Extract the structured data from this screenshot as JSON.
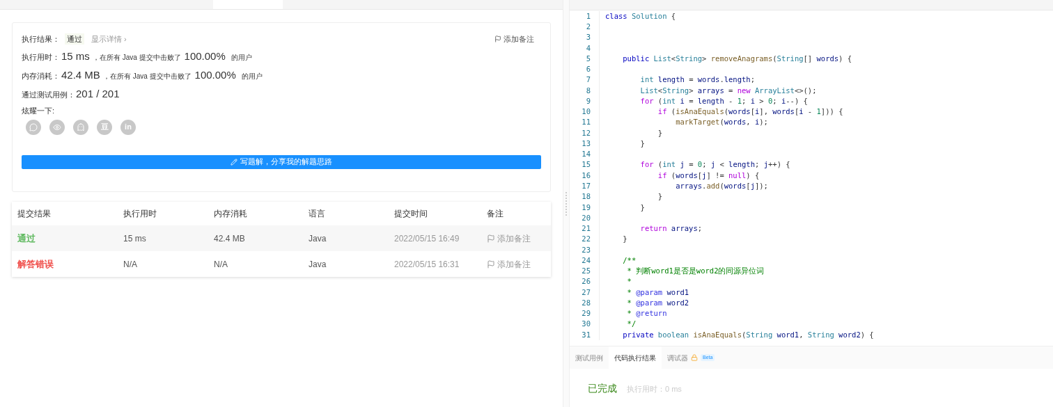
{
  "summary": {
    "result_label": "执行结果：",
    "result_badge": "通过",
    "details_link": "显示详情 ›",
    "add_note": "添加备注",
    "stats": [
      {
        "label": "执行用时：",
        "value": "15 ms",
        "text": "，在所有 Java 提交中击败了",
        "percent": "100.00%",
        "suffix": "的用户"
      },
      {
        "label": "内存消耗：",
        "value": "42.4 MB",
        "text": "，在所有 Java 提交中击败了",
        "percent": "100.00%",
        "suffix": "的用户"
      }
    ],
    "tests_label": "通过测试用例：",
    "tests_value": "201 / 201",
    "share_label": "炫耀一下:",
    "share_icons": [
      {
        "kind": "chat"
      },
      {
        "kind": "eye"
      },
      {
        "kind": "penguin"
      },
      {
        "kind": "glyph",
        "text": "豆"
      },
      {
        "kind": "glyph",
        "text": "in"
      }
    ],
    "write_button": "写题解，分享我的解题思路"
  },
  "table": {
    "columns": [
      "提交结果",
      "执行用时",
      "内存消耗",
      "语言",
      "提交时间",
      "备注"
    ],
    "rows": [
      {
        "status": "通过",
        "color": "#5cb85c",
        "runtime": "15 ms",
        "memory": "42.4 MB",
        "language": "Java",
        "time": "2022/05/15 16:49",
        "note": "添加备注"
      },
      {
        "status": "解答错误",
        "color": "#f0504c",
        "runtime": "N/A",
        "memory": "N/A",
        "language": "Java",
        "time": "2022/05/15 16:31",
        "note": "添加备注"
      }
    ]
  },
  "editor": {
    "lines": [
      {
        "number": "1",
        "tokens": [
          {
            "text": "class",
            "kind": "kw"
          },
          {
            "text": " Solution",
            "kind": "type"
          },
          {
            "text": " {",
            "kind": "p"
          }
        ]
      },
      {
        "number": "2"
      },
      {
        "number": "3"
      },
      {
        "number": "4"
      },
      {
        "number": "5",
        "tokens": [
          {
            "text": "    public",
            "kind": "kw"
          },
          {
            "text": " List",
            "kind": "type"
          },
          {
            "text": "<",
            "kind": "p"
          },
          {
            "text": "String",
            "kind": "type"
          },
          {
            "text": "> ",
            "kind": "p"
          },
          {
            "text": "removeAnagrams",
            "kind": "fn"
          },
          {
            "text": "(",
            "kind": "p"
          },
          {
            "text": "String",
            "kind": "type"
          },
          {
            "text": "[] ",
            "kind": "p"
          },
          {
            "text": "words",
            "kind": "var"
          },
          {
            "text": ") {",
            "kind": "p"
          }
        ]
      },
      {
        "number": "6"
      },
      {
        "number": "7",
        "tokens": [
          {
            "text": "        int",
            "kind": "type"
          },
          {
            "text": " length",
            "kind": "var"
          },
          {
            "text": " = ",
            "kind": "p"
          },
          {
            "text": "words",
            "kind": "var"
          },
          {
            "text": ".",
            "kind": "p"
          },
          {
            "text": "length",
            "kind": "var"
          },
          {
            "text": ";",
            "kind": "p"
          }
        ]
      },
      {
        "number": "8",
        "tokens": [
          {
            "text": "        List",
            "kind": "type"
          },
          {
            "text": "<",
            "kind": "p"
          },
          {
            "text": "String",
            "kind": "type"
          },
          {
            "text": "> ",
            "kind": "p"
          },
          {
            "text": "arrays",
            "kind": "var"
          },
          {
            "text": " = ",
            "kind": "p"
          },
          {
            "text": "new",
            "kind": "ctrl"
          },
          {
            "text": " ArrayList",
            "kind": "type"
          },
          {
            "text": "<>();",
            "kind": "p"
          }
        ]
      },
      {
        "number": "9",
        "tokens": [
          {
            "text": "        for",
            "kind": "ctrl"
          },
          {
            "text": " (",
            "kind": "p"
          },
          {
            "text": "int",
            "kind": "type"
          },
          {
            "text": " i",
            "kind": "var"
          },
          {
            "text": " = ",
            "kind": "p"
          },
          {
            "text": "length",
            "kind": "var"
          },
          {
            "text": " - ",
            "kind": "p"
          },
          {
            "text": "1",
            "kind": "num"
          },
          {
            "text": "; ",
            "kind": "p"
          },
          {
            "text": "i",
            "kind": "var"
          },
          {
            "text": " > ",
            "kind": "p"
          },
          {
            "text": "0",
            "kind": "num"
          },
          {
            "text": "; ",
            "kind": "p"
          },
          {
            "text": "i",
            "kind": "var"
          },
          {
            "text": "--) {",
            "kind": "p"
          }
        ]
      },
      {
        "number": "10",
        "tokens": [
          {
            "text": "            if",
            "kind": "ctrl"
          },
          {
            "text": " (",
            "kind": "p"
          },
          {
            "text": "isAnaEquals",
            "kind": "fn"
          },
          {
            "text": "(",
            "kind": "p"
          },
          {
            "text": "words",
            "kind": "var"
          },
          {
            "text": "[",
            "kind": "p"
          },
          {
            "text": "i",
            "kind": "var"
          },
          {
            "text": "], ",
            "kind": "p"
          },
          {
            "text": "words",
            "kind": "var"
          },
          {
            "text": "[",
            "kind": "p"
          },
          {
            "text": "i",
            "kind": "var"
          },
          {
            "text": " - ",
            "kind": "p"
          },
          {
            "text": "1",
            "kind": "num"
          },
          {
            "text": "])) {",
            "kind": "p"
          }
        ]
      },
      {
        "number": "11",
        "tokens": [
          {
            "text": "                markTarget",
            "kind": "fn"
          },
          {
            "text": "(",
            "kind": "p"
          },
          {
            "text": "words",
            "kind": "var"
          },
          {
            "text": ", ",
            "kind": "p"
          },
          {
            "text": "i",
            "kind": "var"
          },
          {
            "text": ");",
            "kind": "p"
          }
        ]
      },
      {
        "number": "12",
        "tokens": [
          {
            "text": "            }",
            "kind": "p"
          }
        ]
      },
      {
        "number": "13",
        "tokens": [
          {
            "text": "        }",
            "kind": "p"
          }
        ]
      },
      {
        "number": "14"
      },
      {
        "number": "15",
        "tokens": [
          {
            "text": "        for",
            "kind": "ctrl"
          },
          {
            "text": " (",
            "kind": "p"
          },
          {
            "text": "int",
            "kind": "type"
          },
          {
            "text": " j",
            "kind": "var"
          },
          {
            "text": " = ",
            "kind": "p"
          },
          {
            "text": "0",
            "kind": "num"
          },
          {
            "text": "; ",
            "kind": "p"
          },
          {
            "text": "j",
            "kind": "var"
          },
          {
            "text": " < ",
            "kind": "p"
          },
          {
            "text": "length",
            "kind": "var"
          },
          {
            "text": "; ",
            "kind": "p"
          },
          {
            "text": "j",
            "kind": "var"
          },
          {
            "text": "++) {",
            "kind": "p"
          }
        ]
      },
      {
        "number": "16",
        "tokens": [
          {
            "text": "            if",
            "kind": "ctrl"
          },
          {
            "text": " (",
            "kind": "p"
          },
          {
            "text": "words",
            "kind": "var"
          },
          {
            "text": "[",
            "kind": "p"
          },
          {
            "text": "j",
            "kind": "var"
          },
          {
            "text": "] != ",
            "kind": "p"
          },
          {
            "text": "null",
            "kind": "ctrl"
          },
          {
            "text": ") {",
            "kind": "p"
          }
        ]
      },
      {
        "number": "17",
        "tokens": [
          {
            "text": "                arrays",
            "kind": "var"
          },
          {
            "text": ".",
            "kind": "p"
          },
          {
            "text": "add",
            "kind": "fn"
          },
          {
            "text": "(",
            "kind": "p"
          },
          {
            "text": "words",
            "kind": "var"
          },
          {
            "text": "[",
            "kind": "p"
          },
          {
            "text": "j",
            "kind": "var"
          },
          {
            "text": "]);",
            "kind": "p"
          }
        ]
      },
      {
        "number": "18",
        "tokens": [
          {
            "text": "            }",
            "kind": "p"
          }
        ]
      },
      {
        "number": "19",
        "tokens": [
          {
            "text": "        }",
            "kind": "p"
          }
        ]
      },
      {
        "number": "20"
      },
      {
        "number": "21",
        "tokens": [
          {
            "text": "        return",
            "kind": "ctrl"
          },
          {
            "text": " arrays",
            "kind": "var"
          },
          {
            "text": ";",
            "kind": "p"
          }
        ]
      },
      {
        "number": "22",
        "tokens": [
          {
            "text": "    }",
            "kind": "p"
          }
        ]
      },
      {
        "number": "23"
      },
      {
        "number": "24",
        "tokens": [
          {
            "text": "    /**",
            "kind": "comment"
          }
        ]
      },
      {
        "number": "25",
        "tokens": [
          {
            "text": "     * 判断word1是否是word2的同源异位词",
            "kind": "comment"
          }
        ]
      },
      {
        "number": "26",
        "tokens": [
          {
            "text": "     *",
            "kind": "comment"
          }
        ]
      },
      {
        "number": "27",
        "tokens": [
          {
            "text": "     *",
            "kind": "comment"
          },
          {
            "text": " @param",
            "kind": "tag"
          },
          {
            "text": " word1",
            "kind": "var"
          }
        ]
      },
      {
        "number": "28",
        "tokens": [
          {
            "text": "     *",
            "kind": "comment"
          },
          {
            "text": " @param",
            "kind": "tag"
          },
          {
            "text": " word2",
            "kind": "var"
          }
        ]
      },
      {
        "number": "29",
        "tokens": [
          {
            "text": "     *",
            "kind": "comment"
          },
          {
            "text": " @return",
            "kind": "tag"
          }
        ]
      },
      {
        "number": "30",
        "tokens": [
          {
            "text": "     */",
            "kind": "comment"
          }
        ]
      },
      {
        "number": "31",
        "tokens": [
          {
            "text": "    private",
            "kind": "kw"
          },
          {
            "text": " boolean",
            "kind": "type"
          },
          {
            "text": " isAnaEquals",
            "kind": "fn"
          },
          {
            "text": "(",
            "kind": "p"
          },
          {
            "text": "String",
            "kind": "type"
          },
          {
            "text": " word1",
            "kind": "var"
          },
          {
            "text": ", ",
            "kind": "p"
          },
          {
            "text": "String",
            "kind": "type"
          },
          {
            "text": " word2",
            "kind": "var"
          },
          {
            "text": ") {",
            "kind": "p"
          }
        ]
      }
    ]
  },
  "console": {
    "tabs": [
      {
        "label": "测试用例",
        "selected": false,
        "locked": false
      },
      {
        "label": "代码执行结果",
        "selected": true,
        "locked": false
      },
      {
        "label": "调试器",
        "selected": false,
        "locked": true,
        "badge": "Beta"
      }
    ],
    "status": "已完成",
    "runtime": "执行用时：0 ms"
  }
}
